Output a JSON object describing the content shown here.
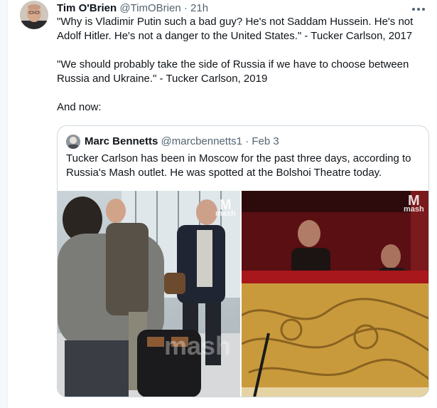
{
  "author": {
    "name": "Tim O'Brien",
    "handle": "@TimOBrien",
    "separator": "·",
    "time": "21h"
  },
  "tweet": {
    "paragraphs": [
      "\"Why is Vladimir Putin such a bad guy? He's not Saddam Hussein. He's not Adolf Hitler. He's not a danger to the United States.\" - Tucker Carlson, 2017",
      "\"We should probably take the side of Russia if we have to choose between Russia and Ukraine.\" - Tucker Carlson, 2019",
      "And now:"
    ]
  },
  "quoted": {
    "name": "Marc Bennetts",
    "handle": "@marcbennetts1",
    "separator": "·",
    "date": "Feb 3",
    "text": "Tucker Carlson has been in Moscow for the past three days, according to Russia's Mash outlet. He was spotted at the Bolshoi Theatre today.",
    "watermarks": [
      "mash",
      "mash"
    ]
  },
  "icons": {
    "more": "more-options-icon",
    "avatar": "profile-avatar",
    "quoted_avatar": "quoted-profile-avatar"
  },
  "colors": {
    "text": "#0f1419",
    "secondary": "#536471",
    "border": "#cfd9de"
  }
}
